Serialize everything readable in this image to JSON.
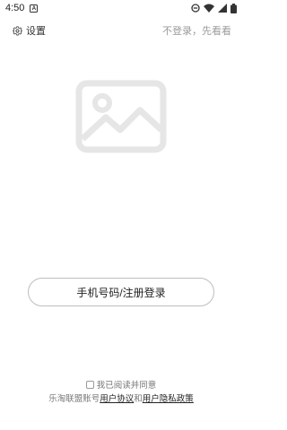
{
  "status_bar": {
    "time": "4:50",
    "notification_badge": "A"
  },
  "header": {
    "settings_label": "设置",
    "skip_login_label": "不登录，先看看"
  },
  "main": {
    "placeholder_icon": "image-placeholder-icon",
    "login_button_label": "手机号码/注册登录"
  },
  "footer": {
    "agree_label": "我已阅读并同意",
    "agreement_prefix": "乐淘联盟账号",
    "user_agreement": "用户协议",
    "and": "和",
    "privacy_policy": "用户隐私政策"
  }
}
